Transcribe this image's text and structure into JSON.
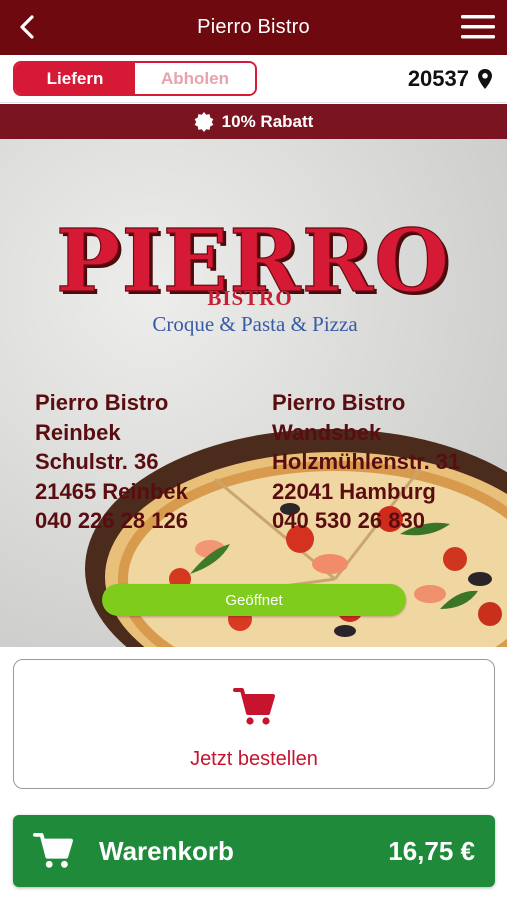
{
  "header": {
    "title": "Pierro Bistro",
    "back_icon": "chevron-left-icon",
    "menu_icon": "hamburger-menu-icon"
  },
  "mode_toggle": {
    "options": [
      "Liefern",
      "Abholen"
    ],
    "selected": "Liefern"
  },
  "location": {
    "zip": "20537",
    "icon": "map-pin-icon"
  },
  "discount_banner": {
    "text": "10% Rabatt",
    "icon": "badge-icon"
  },
  "hero": {
    "logo": {
      "name": "PIERRO",
      "subtitle": "BISTRO",
      "tagline": "Croque & Pasta & Pizza"
    },
    "locations": [
      {
        "name": "Pierro Bistro",
        "district": "Reinbek",
        "street": "Schulstr. 36",
        "city": "21465 Reinbek",
        "phone": "040 226 28 126"
      },
      {
        "name": "Pierro Bistro",
        "district": "Wandsbek",
        "street": "Holzmühlenstr. 31",
        "city": "22041 Hamburg",
        "phone": "040 530 26 830"
      }
    ],
    "status": "Geöffnet"
  },
  "order_card": {
    "label": "Jetzt bestellen",
    "icon": "shopping-cart-icon"
  },
  "cart_bar": {
    "label": "Warenkorb",
    "total": "16,75 €",
    "icon": "shopping-cart-icon"
  },
  "colors": {
    "header_bg": "#6e0a0f",
    "accent_red": "#d61a36",
    "banner_bg": "#7a1420",
    "open_green": "#7fcc1c",
    "cart_green": "#1e8a3a"
  }
}
